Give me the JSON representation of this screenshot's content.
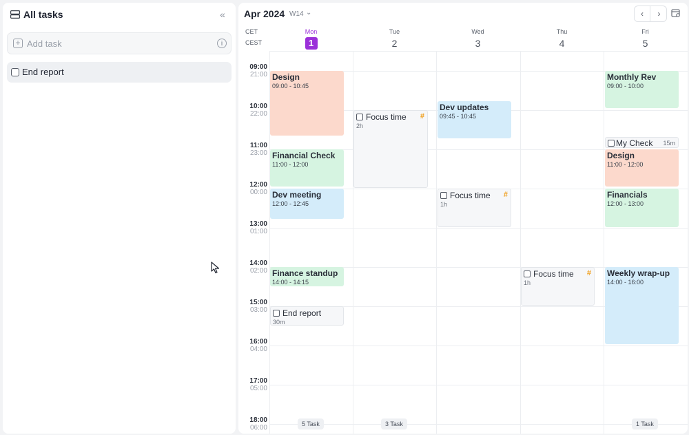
{
  "sidebar": {
    "title": "All tasks",
    "add_task_placeholder": "Add task",
    "tasks": [
      {
        "label": "End report"
      }
    ]
  },
  "calendar": {
    "month": "Apr 2024",
    "week": "W14",
    "timezones": [
      "CET",
      "CEST"
    ],
    "days": [
      {
        "name": "Mon",
        "number": "1"
      },
      {
        "name": "Tue",
        "number": "2"
      },
      {
        "name": "Wed",
        "number": "3"
      },
      {
        "name": "Thu",
        "number": "4"
      },
      {
        "name": "Fri",
        "number": "5"
      }
    ],
    "hours": [
      {
        "cet": "09:00",
        "cest": "21:00"
      },
      {
        "cet": "10:00",
        "cest": "22:00"
      },
      {
        "cet": "11:00",
        "cest": "23:00"
      },
      {
        "cet": "12:00",
        "cest": "00:00"
      },
      {
        "cet": "13:00",
        "cest": "01:00"
      },
      {
        "cet": "14:00",
        "cest": "02:00"
      },
      {
        "cet": "15:00",
        "cest": "03:00"
      },
      {
        "cet": "16:00",
        "cest": "04:00"
      },
      {
        "cet": "17:00",
        "cest": "05:00"
      },
      {
        "cet": "18:00",
        "cest": "06:00"
      }
    ],
    "events": {
      "mon_design": {
        "title": "Design",
        "time": "09:00 - 10:45"
      },
      "mon_financial_check": {
        "title": "Financial Check",
        "time": "11:00 - 12:00"
      },
      "mon_dev_meeting": {
        "title": "Dev meeting",
        "time": "12:00 - 12:45"
      },
      "mon_finance_standup": {
        "title": "Finance standup",
        "time": "14:00 - 14:15"
      },
      "mon_end_report": {
        "title": "End report",
        "duration": "30m"
      },
      "tue_focus_time": {
        "title": "Focus time",
        "duration": "2h",
        "tag": "#"
      },
      "wed_dev_updates": {
        "title": "Dev updates",
        "time": "09:45 - 10:45"
      },
      "wed_focus_time": {
        "title": "Focus time",
        "duration": "1h",
        "tag": "#"
      },
      "thu_focus_time": {
        "title": "Focus time",
        "duration": "1h",
        "tag": "#"
      },
      "fri_monthly_rev": {
        "title": "Monthly Rev",
        "time": "09:00 - 10:00"
      },
      "fri_my_check": {
        "title": "My Check",
        "duration": "15m"
      },
      "fri_design": {
        "title": "Design",
        "time": "11:00 - 12:00"
      },
      "fri_financials": {
        "title": "Financials",
        "time": "12:00 - 13:00"
      },
      "fri_weekly_wrapup": {
        "title": "Weekly wrap-up",
        "time": "14:00 - 16:00"
      }
    },
    "task_counts": {
      "mon": "5 Task",
      "tue": "3 Task",
      "fri": "1 Task"
    }
  },
  "colors": {
    "accent": "#9b30d9",
    "salmon": "#fcd9cc",
    "green": "#d6f4e1",
    "blue": "#d4ecfa",
    "tag": "#f0a020"
  },
  "icons": {
    "list": "list-icon",
    "collapse": "double-chevron-left-icon",
    "add": "plus-square-icon",
    "info": "info-icon",
    "settings": "calendar-settings-icon",
    "cursor": "mouse-pointer-icon"
  }
}
